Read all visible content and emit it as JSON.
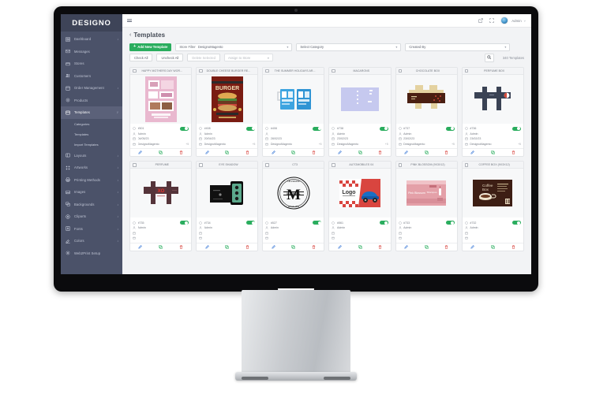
{
  "brand": {
    "name": "DESIGNO"
  },
  "sidebar": {
    "items": [
      {
        "label": "Dashboard",
        "icon": "dashboard-icon",
        "caret": "›",
        "active": false
      },
      {
        "label": "Messages",
        "icon": "messages-icon",
        "caret": "",
        "active": false
      },
      {
        "label": "Stores",
        "icon": "stores-icon",
        "caret": "",
        "active": false
      },
      {
        "label": "Customers",
        "icon": "customers-icon",
        "caret": "",
        "active": false
      },
      {
        "label": "Order Management",
        "icon": "orders-icon",
        "caret": "›",
        "active": false
      },
      {
        "label": "Products",
        "icon": "products-icon",
        "caret": "",
        "active": false
      },
      {
        "label": "Templates",
        "icon": "templates-icon",
        "caret": "˅",
        "active": true
      }
    ],
    "sub_items": [
      {
        "label": "Categories"
      },
      {
        "label": "Templates"
      },
      {
        "label": "Import Templates"
      }
    ],
    "items_after": [
      {
        "label": "Layouts",
        "icon": "layouts-icon",
        "caret": "›"
      },
      {
        "label": "Artworks",
        "icon": "artworks-icon",
        "caret": "›"
      },
      {
        "label": "Printing Methods",
        "icon": "printing-methods-icon",
        "caret": "›"
      },
      {
        "label": "Images",
        "icon": "images-icon",
        "caret": "›"
      },
      {
        "label": "Backgrounds",
        "icon": "backgrounds-icon",
        "caret": "›"
      },
      {
        "label": "Cliparts",
        "icon": "cliparts-icon",
        "caret": "›"
      },
      {
        "label": "Fonts",
        "icon": "fonts-icon",
        "caret": "›"
      },
      {
        "label": "Colors",
        "icon": "colors-icon",
        "caret": "›"
      },
      {
        "label": "Web2Print Setup",
        "icon": "web2print-setup-icon",
        "caret": ""
      }
    ]
  },
  "topbar": {
    "user_name": "Admin",
    "user_caret": "˅"
  },
  "page": {
    "back_chevron": "‹",
    "title": "Templates"
  },
  "toolbar": {
    "add_label": "Add New Template",
    "add_plus": "+",
    "store_filter_label": "Store Filter",
    "store_filter_value": "DesignoMagento",
    "category_value": "Select Category",
    "created_by_value": "Created By",
    "check_all_label": "Check All",
    "uncheck_all_label": "Uncheck All",
    "delete_selected_label": "Delete Selected",
    "assign_to_store_label": "Assign to Store",
    "caret": "▾",
    "count_text": "340 Templates"
  },
  "colors": {
    "brand_bar": "#3e4458",
    "sidebar": "#4b5269",
    "accent_green": "#2aad5e",
    "edit_blue": "#2d6fd4",
    "delete_red": "#d9453f"
  },
  "cards": [
    {
      "title": "HAPPY MOTHERS DAY WOR...",
      "id": "#501",
      "author": "Admin",
      "date": "04/05/23",
      "store": "DesignoMagento",
      "extra": "+5",
      "thumb": "mothers-day-card",
      "enabled": true
    },
    {
      "title": "DOUBLE CHEESE BURGER RE...",
      "id": "#408",
      "author": "Admin",
      "date": "20/04/23",
      "store": "DesignoMagento",
      "extra": "+5",
      "thumb": "burger-poster",
      "enabled": true
    },
    {
      "title": "THE SUMMER HOLIDAYS AR...",
      "id": "#408",
      "author": "",
      "date": "28/02/23",
      "store": "DesignoMagento",
      "extra": "+5",
      "thumb": "summer-mug",
      "enabled": true
    },
    {
      "title": "MACARONS",
      "id": "#738",
      "author": "Admin",
      "date": "23/02/23",
      "store": "DesignoMagento",
      "extra": "+5",
      "thumb": "macarons-box",
      "enabled": true
    },
    {
      "title": "CHOCOLATE BOX",
      "id": "#737",
      "author": "Admin",
      "date": "23/02/23",
      "store": "DesignoMagento",
      "extra": "+5",
      "thumb": "chocolate-box",
      "enabled": true
    },
    {
      "title": "PERFUME BOX",
      "id": "#736",
      "author": "Admin",
      "date": "23/02/23",
      "store": "DesignoMagento",
      "extra": "+5",
      "thumb": "perfume-box-dieline",
      "enabled": true
    },
    {
      "title": "PERFUME",
      "id": "#735",
      "author": "Admin",
      "date": "",
      "store": "",
      "extra": "",
      "thumb": "perfume-red",
      "enabled": true
    },
    {
      "title": "EYE SHADOW",
      "id": "#734",
      "author": "Admin",
      "date": "",
      "store": "",
      "extra": "",
      "thumb": "eye-shadow-box",
      "enabled": true
    },
    {
      "title": "CT3",
      "id": "#527",
      "author": "Admin",
      "date": "",
      "store": "",
      "extra": "",
      "thumb": "maxwell-badge",
      "enabled": true
    },
    {
      "title": "AUTOMOBILES 04",
      "id": "#561",
      "author": "Admin",
      "date": "",
      "store": "",
      "extra": "",
      "thumb": "automobile-logo",
      "enabled": true
    },
    {
      "title": "PINK BLOSSOM (9X3X12)",
      "id": "#733",
      "author": "Admin",
      "date": "",
      "store": "",
      "extra": "",
      "thumb": "pink-blossom-box",
      "enabled": true
    },
    {
      "title": "COFFEE BOX (9X3X12)",
      "id": "#732",
      "author": "Admin",
      "date": "",
      "store": "",
      "extra": "",
      "thumb": "coffee-box",
      "enabled": true
    }
  ]
}
